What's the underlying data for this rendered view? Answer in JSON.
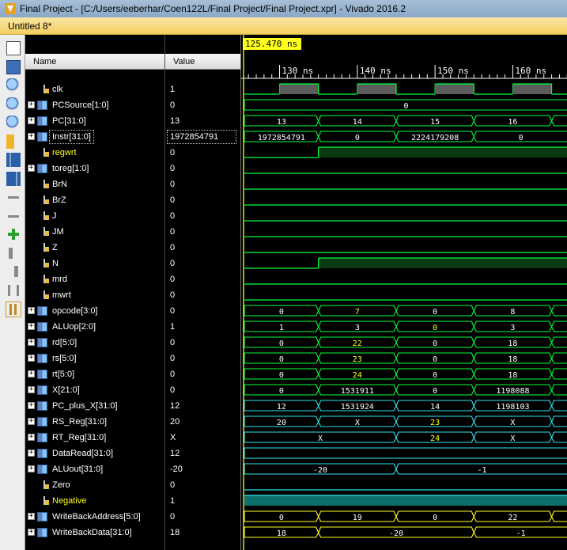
{
  "window": {
    "title": "Final Project - [C:/Users/eeberhar/Coen122L/Final Project/Final Project.xpr] - Vivado 2016.2"
  },
  "tab": {
    "label": "Untitled 8*"
  },
  "columns": {
    "name": "Name",
    "value": "Value"
  },
  "cursor": {
    "time_label": "125.470 ns"
  },
  "time_ticks": [
    {
      "label": "130 ns",
      "ns": 130
    },
    {
      "label": "140 ns",
      "ns": 140
    },
    {
      "label": "150 ns",
      "ns": 150
    },
    {
      "label": "160 ns",
      "ns": 160
    }
  ],
  "toolbar_icons": [
    "zoom-fit-icon",
    "save-icon",
    "zoom-in-icon",
    "zoom-out-icon",
    "zoom-full-icon",
    "goto-cursor-icon",
    "goto-start-icon",
    "goto-end-icon",
    "prev-transition-icon",
    "next-transition-icon",
    "add-marker-icon",
    "prev-marker-icon",
    "next-marker-icon",
    "swap-cursors-icon",
    "snap-to-transition-icon"
  ],
  "colors": {
    "green": "#00ff3c",
    "yellow": "#ffff1e",
    "cyan": "#2ee6ee",
    "selected_teal": "#0f6f6a"
  },
  "signals": [
    {
      "name": "clk",
      "value": "1",
      "bus": false,
      "expandable": false,
      "color": "#00ff3c",
      "wave": "clk"
    },
    {
      "name": "PCSource[1:0]",
      "value": "0",
      "bus": true,
      "expandable": true,
      "color": "#00ff3c",
      "segs": [
        [
          "0",
          125.47,
          168
        ]
      ]
    },
    {
      "name": "PC[31:0]",
      "value": "13",
      "bus": true,
      "expandable": true,
      "color": "#00ff3c",
      "segs": [
        [
          "13",
          125.47,
          135
        ],
        [
          "14",
          135,
          145
        ],
        [
          "15",
          145,
          155
        ],
        [
          "16",
          155,
          165
        ],
        [
          "",
          165,
          168
        ]
      ]
    },
    {
      "name": "Instr[31:0]",
      "value": "1972854791",
      "bus": true,
      "expandable": true,
      "selected": true,
      "color": "#00ff3c",
      "segs": [
        [
          "1972854791",
          125.47,
          135
        ],
        [
          "0",
          135,
          145
        ],
        [
          "2224179208",
          145,
          155
        ],
        [
          "0",
          155,
          168
        ]
      ]
    },
    {
      "name": "regwrt",
      "value": "0",
      "bus": false,
      "expandable": false,
      "yellow_label": true,
      "color": "#00ff3c",
      "bits": [
        [
          0,
          125.47,
          135
        ],
        [
          1,
          135,
          168
        ]
      ]
    },
    {
      "name": "toreg[1:0]",
      "value": "0",
      "bus": true,
      "expandable": true,
      "color": "#00ff3c",
      "bits": [
        [
          0,
          125.47,
          168
        ]
      ]
    },
    {
      "name": "BrN",
      "value": "0",
      "bus": false,
      "expandable": false,
      "color": "#00ff3c",
      "bits": [
        [
          0,
          125.47,
          168
        ]
      ]
    },
    {
      "name": "BrZ",
      "value": "0",
      "bus": false,
      "expandable": false,
      "color": "#00ff3c",
      "bits": [
        [
          0,
          125.47,
          168
        ]
      ]
    },
    {
      "name": "J",
      "value": "0",
      "bus": false,
      "expandable": false,
      "color": "#00ff3c",
      "bits": [
        [
          0,
          125.47,
          168
        ]
      ]
    },
    {
      "name": "JM",
      "value": "0",
      "bus": false,
      "expandable": false,
      "color": "#00ff3c",
      "bits": [
        [
          0,
          125.47,
          168
        ]
      ]
    },
    {
      "name": "Z",
      "value": "0",
      "bus": false,
      "expandable": false,
      "color": "#00ff3c",
      "bits": [
        [
          0,
          125.47,
          168
        ]
      ]
    },
    {
      "name": "N",
      "value": "0",
      "bus": false,
      "expandable": false,
      "color": "#00ff3c",
      "bits": [
        [
          0,
          125.47,
          135
        ],
        [
          1,
          135,
          168
        ]
      ]
    },
    {
      "name": "mrd",
      "value": "0",
      "bus": false,
      "expandable": false,
      "color": "#00ff3c",
      "bits": [
        [
          0,
          125.47,
          168
        ]
      ]
    },
    {
      "name": "mwrt",
      "value": "0",
      "bus": false,
      "expandable": false,
      "color": "#00ff3c",
      "bits": [
        [
          0,
          125.47,
          168
        ]
      ]
    },
    {
      "name": "opcode[3:0]",
      "value": "0",
      "bus": true,
      "expandable": true,
      "color": "#00ff3c",
      "segs": [
        [
          "0",
          125.47,
          135
        ],
        [
          "7",
          135,
          145,
          "#ffff1e"
        ],
        [
          "0",
          145,
          155
        ],
        [
          "8",
          155,
          165
        ],
        [
          "",
          165,
          168
        ]
      ]
    },
    {
      "name": "ALUop[2:0]",
      "value": "1",
      "bus": true,
      "expandable": true,
      "color": "#00ff3c",
      "segs": [
        [
          "1",
          125.47,
          135
        ],
        [
          "3",
          135,
          145
        ],
        [
          "0",
          145,
          155,
          "#ffff1e"
        ],
        [
          "3",
          155,
          165
        ],
        [
          "",
          165,
          168
        ]
      ]
    },
    {
      "name": "rd[5:0]",
      "value": "0",
      "bus": true,
      "expandable": true,
      "color": "#00ff3c",
      "segs": [
        [
          "0",
          125.47,
          135
        ],
        [
          "22",
          135,
          145,
          "#ffff1e"
        ],
        [
          "0",
          145,
          155
        ],
        [
          "18",
          155,
          165
        ],
        [
          "",
          165,
          168
        ]
      ]
    },
    {
      "name": "rs[5:0]",
      "value": "0",
      "bus": true,
      "expandable": true,
      "color": "#00ff3c",
      "segs": [
        [
          "0",
          125.47,
          135
        ],
        [
          "23",
          135,
          145,
          "#ffff1e"
        ],
        [
          "0",
          145,
          155
        ],
        [
          "18",
          155,
          165
        ],
        [
          "",
          165,
          168
        ]
      ]
    },
    {
      "name": "rt[5:0]",
      "value": "0",
      "bus": true,
      "expandable": true,
      "color": "#00ff3c",
      "segs": [
        [
          "0",
          125.47,
          135
        ],
        [
          "24",
          135,
          145,
          "#ffff1e"
        ],
        [
          "0",
          145,
          155
        ],
        [
          "18",
          155,
          165
        ],
        [
          "",
          165,
          168
        ]
      ]
    },
    {
      "name": "X[21:0]",
      "value": "0",
      "bus": true,
      "expandable": true,
      "color": "#00ff3c",
      "segs": [
        [
          "0",
          125.47,
          135
        ],
        [
          "1531911",
          135,
          145
        ],
        [
          "0",
          145,
          155
        ],
        [
          "1198088",
          155,
          165
        ],
        [
          "",
          165,
          168
        ]
      ]
    },
    {
      "name": "PC_plus_X[31:0]",
      "value": "12",
      "bus": true,
      "expandable": true,
      "color": "#2ee6ee",
      "segs": [
        [
          "12",
          125.47,
          135
        ],
        [
          "1531924",
          135,
          145
        ],
        [
          "14",
          145,
          155
        ],
        [
          "1198103",
          155,
          165
        ],
        [
          "",
          165,
          168
        ]
      ]
    },
    {
      "name": "RS_Reg[31:0]",
      "value": "20",
      "bus": true,
      "expandable": true,
      "color": "#2ee6ee",
      "segs": [
        [
          "20",
          125.47,
          135
        ],
        [
          "X",
          135,
          145
        ],
        [
          "23",
          145,
          155,
          "#ffff1e"
        ],
        [
          "X",
          155,
          165
        ],
        [
          "",
          165,
          168
        ]
      ]
    },
    {
      "name": "RT_Reg[31:0]",
      "value": "X",
      "bus": true,
      "expandable": true,
      "color": "#2ee6ee",
      "segs": [
        [
          "X",
          125.47,
          145
        ],
        [
          "24",
          145,
          155,
          "#ffff1e"
        ],
        [
          "X",
          155,
          165
        ],
        [
          "",
          165,
          168
        ]
      ]
    },
    {
      "name": "DataRead[31:0]",
      "value": "12",
      "bus": true,
      "expandable": true,
      "color": "#2ee6ee",
      "segs": [
        [
          "",
          125.47,
          168
        ]
      ]
    },
    {
      "name": "ALUout[31:0]",
      "value": "-20",
      "bus": true,
      "expandable": true,
      "color": "#2ee6ee",
      "segs": [
        [
          "-20",
          125.47,
          145
        ],
        [
          "-1",
          145,
          168
        ]
      ]
    },
    {
      "name": "Zero",
      "value": "0",
      "bus": false,
      "expandable": false,
      "color": "#2ee6ee",
      "bits": [
        [
          0,
          125.47,
          168
        ]
      ]
    },
    {
      "name": "Negative",
      "value": "1",
      "bus": false,
      "expandable": false,
      "yellow_label": true,
      "color": "#2ee6ee",
      "bits": [
        [
          1,
          125.47,
          168
        ]
      ],
      "teal": true
    },
    {
      "name": "WriteBackAddress[5:0]",
      "value": "0",
      "bus": true,
      "expandable": true,
      "color": "#ffff1e",
      "segs": [
        [
          "0",
          125.47,
          135
        ],
        [
          "19",
          135,
          145
        ],
        [
          "0",
          145,
          155
        ],
        [
          "22",
          155,
          165
        ],
        [
          "",
          165,
          168
        ]
      ]
    },
    {
      "name": "WriteBackData[31:0]",
      "value": "18",
      "bus": true,
      "expandable": true,
      "color": "#ffff1e",
      "segs": [
        [
          "18",
          125.47,
          135
        ],
        [
          "-20",
          135,
          155
        ],
        [
          "-1",
          155,
          168
        ]
      ]
    }
  ]
}
